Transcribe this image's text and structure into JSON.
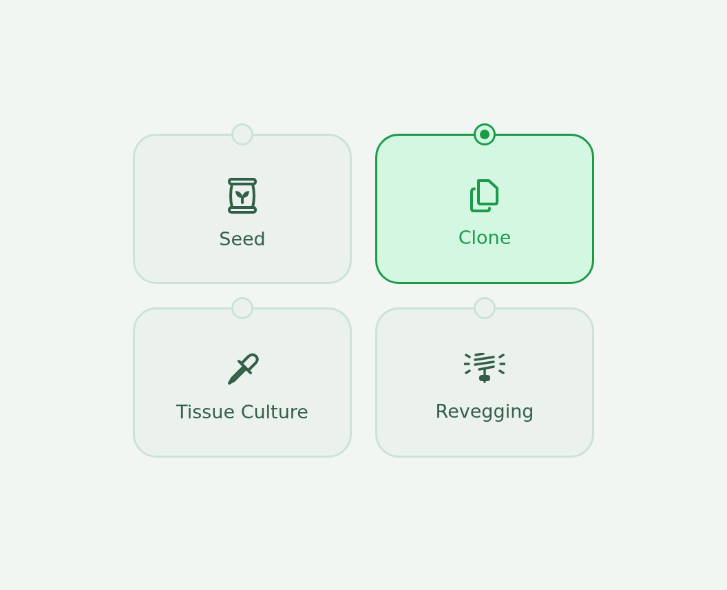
{
  "options": [
    {
      "label": "Seed",
      "kind": "seed",
      "selected": false
    },
    {
      "label": "Clone",
      "kind": "clone",
      "selected": true
    },
    {
      "label": "Tissue Culture",
      "kind": "tissue",
      "selected": false
    },
    {
      "label": "Revegging",
      "kind": "reveg",
      "selected": false
    }
  ]
}
